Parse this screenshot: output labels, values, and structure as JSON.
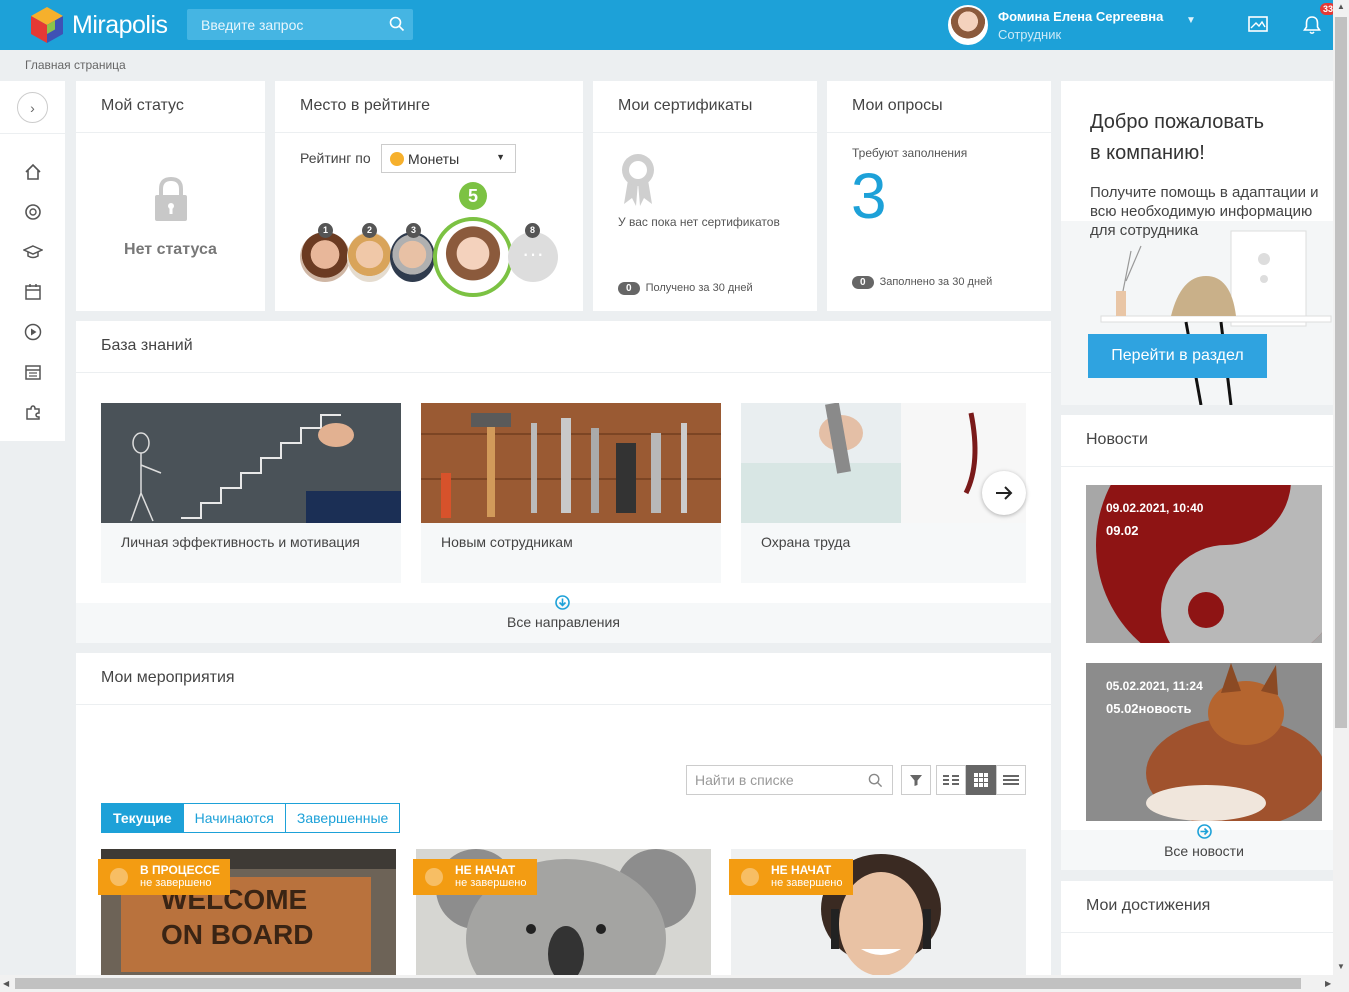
{
  "header": {
    "logo_text": "Mirapolis",
    "search_placeholder": "Введите запрос",
    "user_name": "Фомина Елена Сергеевна",
    "user_role": "Сотрудник",
    "notification_count": "33",
    "brand_color": "#1da1d8"
  },
  "breadcrumb": "Главная страница",
  "sidebar": {
    "icons": [
      "chevron-right-icon",
      "home-icon",
      "badge-icon",
      "graduation-cap-icon",
      "calendar-icon",
      "play-icon",
      "schedule-icon",
      "puzzle-icon"
    ]
  },
  "status_card": {
    "title": "Мой статус",
    "value": "Нет статуса"
  },
  "rating_card": {
    "title": "Место в рейтинге",
    "rating_by_label": "Рейтинг по",
    "currency": "Монеты",
    "my_place": "5",
    "places": [
      "1",
      "2",
      "3",
      "8"
    ]
  },
  "certificates_card": {
    "title": "Мои сертификаты",
    "empty_text": "У вас пока нет сертификатов",
    "count": "0",
    "count_label": "Получено за 30 дней"
  },
  "surveys_card": {
    "title": "Мои опросы",
    "pending_label": "Требуют заполнения",
    "pending_count": "3",
    "count": "0",
    "count_label": "Заполнено за 30 дней"
  },
  "knowledge_base": {
    "title": "База знаний",
    "items": [
      {
        "label": "Личная эффективность и мотивация"
      },
      {
        "label": "Новым сотрудникам"
      },
      {
        "label": "Охрана труда"
      }
    ],
    "all_link": "Все направления"
  },
  "events": {
    "title": "Мои мероприятия",
    "search_placeholder": "Найти в списке",
    "tabs": [
      "Текущие",
      "Начинаются",
      "Завершенные"
    ],
    "cards": [
      {
        "status": "В ПРОЦЕССЕ",
        "substatus": "не завершено"
      },
      {
        "status": "НЕ НАЧАТ",
        "substatus": "не завершено"
      },
      {
        "status": "НЕ НАЧАТ",
        "substatus": "не завершено"
      }
    ]
  },
  "welcome": {
    "title_line1": "Добро пожаловать",
    "title_line2": "в компанию!",
    "text": "Получите помощь в адаптации и всю необходимую информацию для сотрудника",
    "button": "Перейти в раздел"
  },
  "news": {
    "title": "Новости",
    "items": [
      {
        "date": "09.02.2021, 10:40",
        "title": "09.02"
      },
      {
        "date": "05.02.2021, 11:24",
        "title": "05.02новость"
      }
    ],
    "all_link": "Все новости"
  },
  "achievements": {
    "title": "Мои достижения"
  }
}
